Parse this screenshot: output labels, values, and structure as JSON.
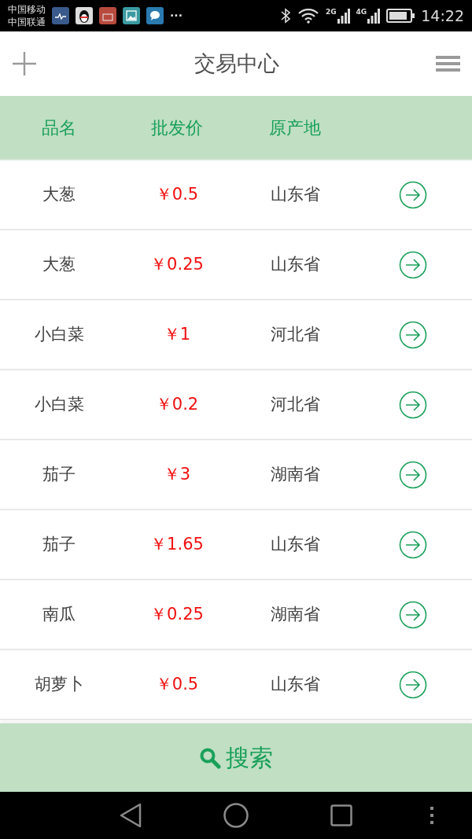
{
  "status_bar": {
    "carriers": [
      "中国移动",
      "中国联通"
    ],
    "more": "···",
    "network_1": "2G",
    "network_2": "4G",
    "time": "14:22"
  },
  "header": {
    "title": "交易中心"
  },
  "table": {
    "columns": [
      "品名",
      "批发价",
      "原产地"
    ],
    "rows": [
      {
        "name": "大葱",
        "price": "￥0.5",
        "origin": "山东省"
      },
      {
        "name": "大葱",
        "price": "￥0.25",
        "origin": "山东省"
      },
      {
        "name": "小白菜",
        "price": "￥1",
        "origin": "河北省"
      },
      {
        "name": "小白菜",
        "price": "￥0.2",
        "origin": "河北省"
      },
      {
        "name": "茄子",
        "price": "￥3",
        "origin": "湖南省"
      },
      {
        "name": "茄子",
        "price": "￥1.65",
        "origin": "山东省"
      },
      {
        "name": "南瓜",
        "price": "￥0.25",
        "origin": "湖南省"
      },
      {
        "name": "胡萝卜",
        "price": "￥0.5",
        "origin": "山东省"
      }
    ]
  },
  "search_button": {
    "label": "搜索"
  }
}
